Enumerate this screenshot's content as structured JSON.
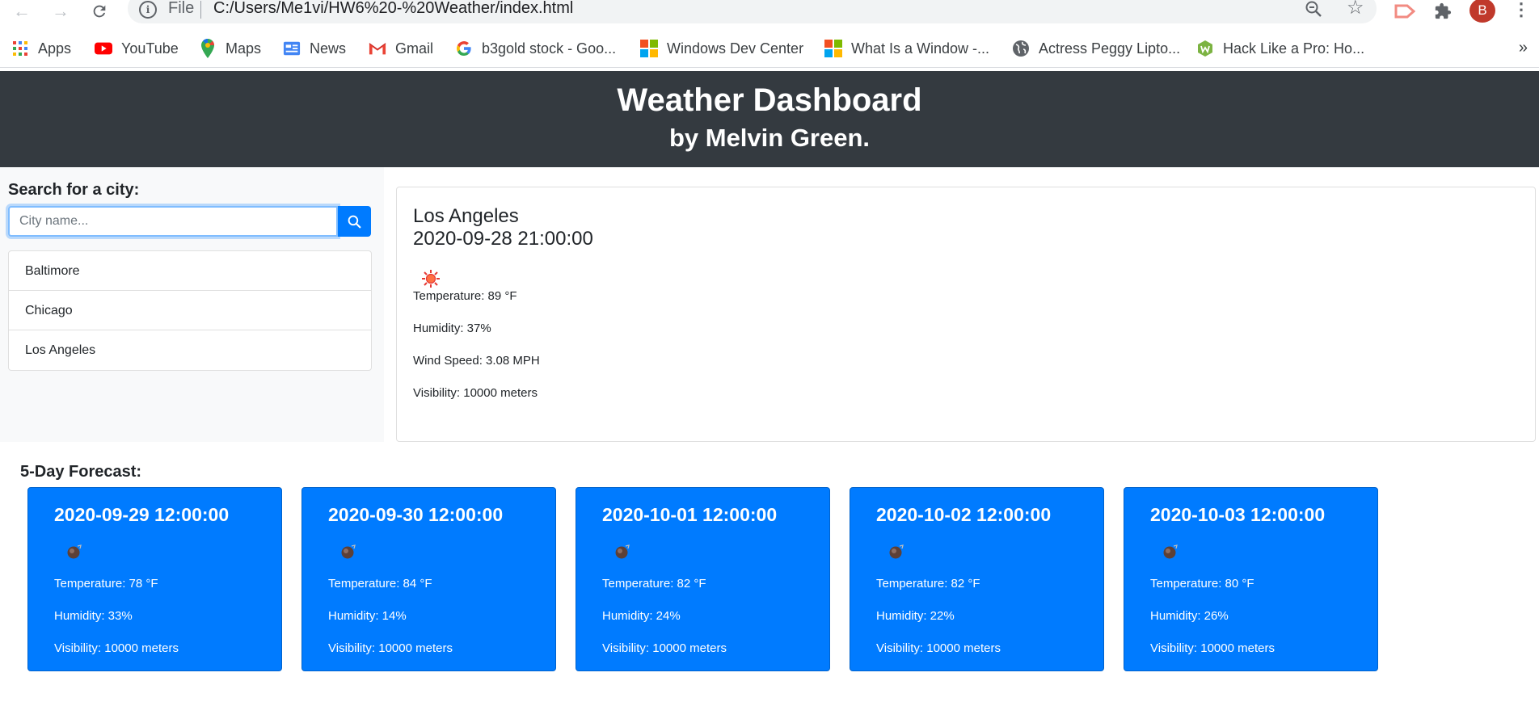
{
  "browser": {
    "omnibox": {
      "scheme_label": "File",
      "url": "C:/Users/Me1vi/HW6%20-%20Weather/index.html"
    },
    "profile_initial": "B",
    "bookmarks": [
      {
        "label": "Apps",
        "icon": "apps-grid-icon"
      },
      {
        "label": "YouTube",
        "icon": "youtube-icon"
      },
      {
        "label": "Maps",
        "icon": "maps-pin-icon"
      },
      {
        "label": "News",
        "icon": "news-icon"
      },
      {
        "label": "Gmail",
        "icon": "gmail-icon"
      },
      {
        "label": "b3gold stock - Goo...",
        "icon": "google-icon"
      },
      {
        "label": "Windows Dev Center",
        "icon": "windows-logo-icon"
      },
      {
        "label": "What Is a Window -...",
        "icon": "windows-logo-icon"
      },
      {
        "label": "Actress Peggy Lipto...",
        "icon": "globe-icon"
      },
      {
        "label": "Hack Like a Pro: Ho...",
        "icon": "wonderhowto-icon"
      }
    ],
    "more_label": "»"
  },
  "header": {
    "title": "Weather Dashboard",
    "subtitle": "by Melvin Green."
  },
  "sidebar": {
    "search_label": "Search for a city:",
    "search_placeholder": "City name...",
    "search_value": "",
    "cities": [
      "Baltimore",
      "Chicago",
      "Los Angeles"
    ]
  },
  "current": {
    "city": "Los Angeles",
    "datetime": "2020-09-28 21:00:00",
    "icon": "sun-icon",
    "temperature": "Temperature: 89 °F",
    "humidity": "Humidity: 37%",
    "wind": "Wind Speed: 3.08 MPH",
    "visibility": "Visibility: 10000 meters"
  },
  "forecast": {
    "title": "5-Day Forecast:",
    "days": [
      {
        "date": "2020-09-29 12:00:00",
        "icon": "weather-icon",
        "temperature": "Temperature: 78 °F",
        "humidity": "Humidity: 33%",
        "visibility": "Visibility: 10000 meters"
      },
      {
        "date": "2020-09-30 12:00:00",
        "icon": "weather-icon",
        "temperature": "Temperature: 84 °F",
        "humidity": "Humidity: 14%",
        "visibility": "Visibility: 10000 meters"
      },
      {
        "date": "2020-10-01 12:00:00",
        "icon": "weather-icon",
        "temperature": "Temperature: 82 °F",
        "humidity": "Humidity: 24%",
        "visibility": "Visibility: 10000 meters"
      },
      {
        "date": "2020-10-02 12:00:00",
        "icon": "weather-icon",
        "temperature": "Temperature: 82 °F",
        "humidity": "Humidity: 22%",
        "visibility": "Visibility: 10000 meters"
      },
      {
        "date": "2020-10-03 12:00:00",
        "icon": "weather-icon",
        "temperature": "Temperature: 80 °F",
        "humidity": "Humidity: 26%",
        "visibility": "Visibility: 10000 meters"
      }
    ]
  },
  "colors": {
    "header_bg": "#343a40",
    "primary": "#007bff",
    "sidebar_bg": "#f8f9fa"
  }
}
